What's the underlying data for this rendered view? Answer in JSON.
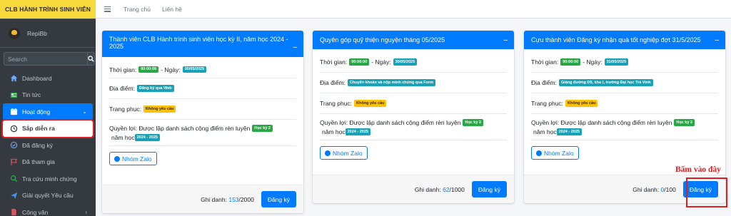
{
  "sidebar": {
    "brand": "CLB HÀNH TRÌNH SINH VIÊN",
    "user_name": "RepiBb",
    "search_placeholder": "Search",
    "items": [
      {
        "label": "Dashboard",
        "icon": "home-icon"
      },
      {
        "label": "Tin tức",
        "icon": "newspaper-icon"
      },
      {
        "label": "Hoạt động",
        "icon": "calendar-icon"
      },
      {
        "label": "Sắp diễn ra",
        "icon": "clock-icon"
      },
      {
        "label": "Đã đăng ký",
        "icon": "check-circle-icon"
      },
      {
        "label": "Đã tham gia",
        "icon": "flag-icon"
      },
      {
        "label": "Tra cứu minh chứng",
        "icon": "search-icon"
      },
      {
        "label": "Giải quyết Yêu cầu",
        "icon": "paper-plane-icon"
      },
      {
        "label": "Công văn",
        "icon": "document-icon"
      }
    ]
  },
  "navbar": {
    "links": [
      "Trang chủ",
      "Liên hệ"
    ]
  },
  "labels": {
    "time": "Thời gian:",
    "date_prefix": "- Ngày:",
    "place": "Địa điểm:",
    "dress": "Trang phục:",
    "benefit": "Quyền lợi: Được lập danh sách cộng điểm rèn luyện",
    "year_word": "năm học",
    "zalo": "Nhóm Zalo",
    "enrolled": "Ghi danh:",
    "register": "Đăng ký"
  },
  "cards": [
    {
      "title": "Thành viên CLB Hành trình sinh viên học kỳ II, năm học 2024 - 2025",
      "time": "00:00:00",
      "date": "30/05/2025",
      "place": "Đăng ký qua Web",
      "dress": "Không yêu cầu",
      "semester": "Học kỳ 2",
      "year": "2024 - 2025",
      "enrolled": "153",
      "capacity": "/2000"
    },
    {
      "title": "Quyên góp quỹ thiện nguyện tháng 05/2025",
      "time": "00:00:00",
      "date": "30/05/2025",
      "place": "Chuyển khoản và nộp minh chứng qua Form",
      "dress": "Không yêu cầu",
      "semester": "Học kỳ 2",
      "year": "2024 - 2025",
      "enrolled": "62",
      "capacity": "/1000"
    },
    {
      "title": "Cựu thành viên Đăng ký nhận quà tốt nghiệp đợt 31/5/2025",
      "time": "00:00:00",
      "date": "31/05/2025",
      "place": "Giảng đường D5, khu I, trường Đại học Trà Vinh",
      "dress": "Không yêu cầu",
      "semester": "Học kỳ 2",
      "year": "2024 - 2025",
      "enrolled": "0",
      "capacity": "/100"
    }
  ],
  "annotation": "Bấm vào đây",
  "colors": {
    "primary": "#007bff",
    "sidebar": "#343a40",
    "brand": "#f8d93c",
    "highlight": "#e01e1e"
  }
}
